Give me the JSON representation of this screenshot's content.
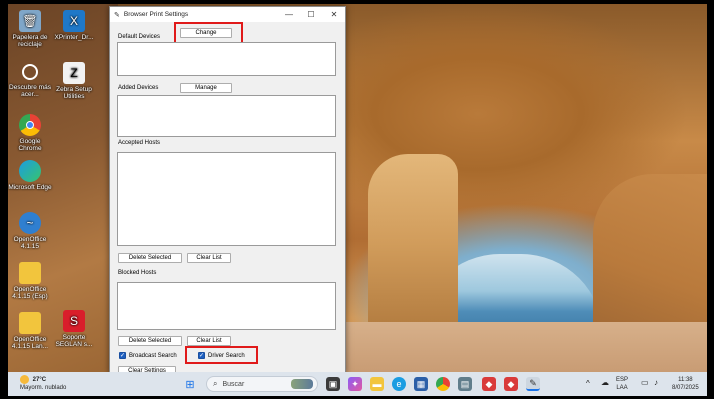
{
  "desktop": {
    "icons": [
      {
        "label": "Papelera de reciclaje",
        "icon": "recycle-bin-icon",
        "color": "#7fa6c8"
      },
      {
        "label": "XPrinter_Dr...",
        "icon": "xprinter-icon",
        "color": "#1f78c8"
      },
      {
        "label": "Descubre más acer...",
        "icon": "discover-icon",
        "color": "#ffffff"
      },
      {
        "label": "Zebra Setup Utilities",
        "icon": "zebra-icon",
        "color": "#f2f2f2"
      },
      {
        "label": "Google Chrome",
        "icon": "chrome-icon",
        "color": "#e94235"
      },
      {
        "label": "Microsoft Edge",
        "icon": "edge-icon",
        "color": "#1b9de2"
      },
      {
        "label": "OpenOffice 4.1.15",
        "icon": "openoffice-icon",
        "color": "#2f7fd0"
      },
      {
        "label": "OpenOffice 4.1.15 (Esp)",
        "icon": "folder-icon",
        "color": "#f2c53d"
      },
      {
        "label": "OpenOffice 4.1.15 Lan...",
        "icon": "folder-icon",
        "color": "#f2c53d"
      },
      {
        "label": "Soporte SEGLAN s...",
        "icon": "seglan-icon",
        "color": "#d91e2b"
      }
    ]
  },
  "window": {
    "title": "Browser Print Settings",
    "default_devices_label": "Default Devices",
    "change_button": "Change",
    "added_devices_label": "Added Devices",
    "manage_button": "Manage",
    "accepted_hosts_label": "Accepted Hosts",
    "delete_selected_1": "Delete Selected",
    "clear_list_1": "Clear List",
    "blocked_hosts_label": "Blocked Hosts",
    "delete_selected_2": "Delete Selected",
    "clear_list_2": "Clear List",
    "broadcast_search": "Broadcast Search",
    "driver_search": "Driver Search",
    "clear_settings": "Clear Settings",
    "highlight_color": "#e01a1a"
  },
  "taskbar": {
    "weather_temp": "27°C",
    "weather_desc": "Mayorm. nublado",
    "search_placeholder": "Buscar",
    "lang_top": "ESP",
    "lang_bottom": "LAA",
    "time": "11:38",
    "date": "8/07/2025"
  }
}
